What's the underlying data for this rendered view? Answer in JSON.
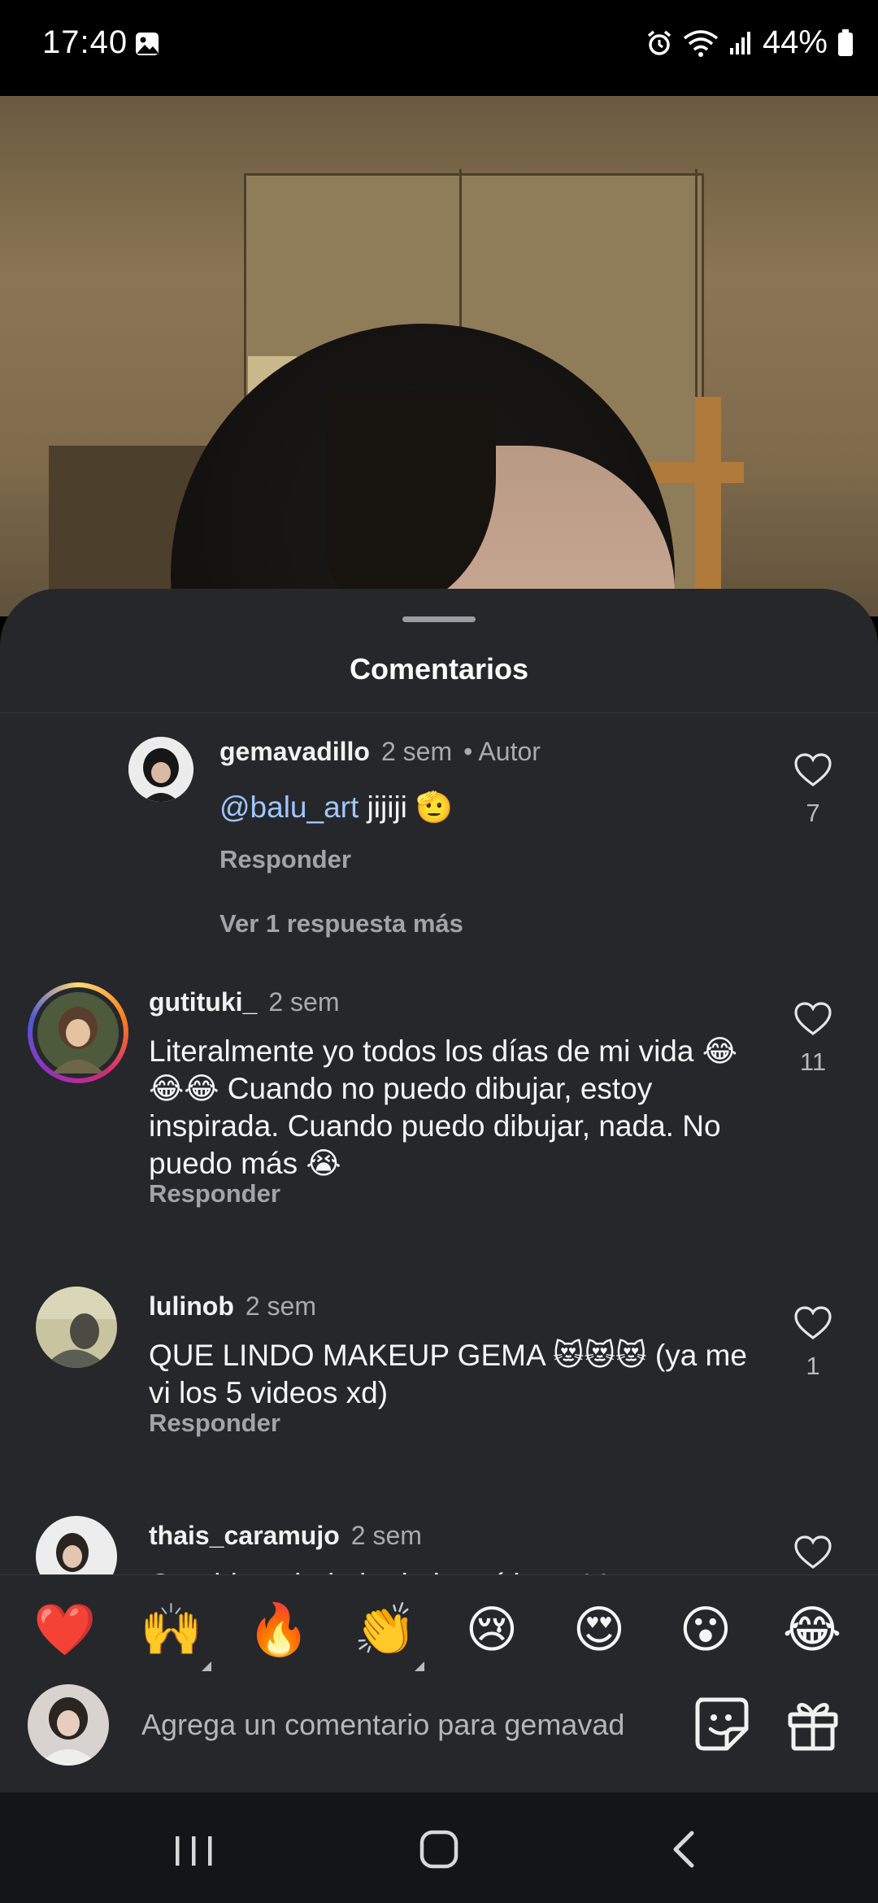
{
  "status_bar": {
    "time": "17:40",
    "battery": "44%",
    "icons": [
      "gallery-icon",
      "alarm-icon",
      "wifi-icon",
      "signal-icon",
      "battery-icon"
    ]
  },
  "sheet": {
    "title": "Comentarios"
  },
  "comments": [
    {
      "username": "gemavadillo",
      "time": "2 sem",
      "author_tag": "• Autor",
      "mention": "@balu_art",
      "text": " jijiji 🫡",
      "reply_label": "Responder",
      "likes": "7",
      "more_replies": "Ver 1 respuesta más"
    },
    {
      "username": "gutituki_",
      "time": "2 sem",
      "text": "Literalmente yo todos los días de mi vida 😂😂😂 Cuando no puedo dibujar, estoy inspirada. Cuando puedo dibujar, nada. No puedo más 😭",
      "reply_label": "Responder",
      "likes": "11"
    },
    {
      "username": "lulinob",
      "time": "2 sem",
      "text": "QUE LINDO MAKEUP GEMA 😻😻😻 (ya me vi los 5 videos xd)",
      "reply_label": "Responder",
      "likes": "1"
    },
    {
      "username": "thais_caramujo",
      "time": "2 sem",
      "text": "Que idea chula la de los vídeos. Voy"
    }
  ],
  "emoji_bar": [
    "❤️",
    "🙌",
    "🔥",
    "👏",
    "😢",
    "😍",
    "😮",
    "😂"
  ],
  "input": {
    "placeholder": "Agrega un comentario para gemavad"
  },
  "colors": {
    "sheet_bg": "#25272b",
    "mention": "#9fc6ff",
    "muted_text": "#a8abb1",
    "story_ring": "#e1306c"
  }
}
